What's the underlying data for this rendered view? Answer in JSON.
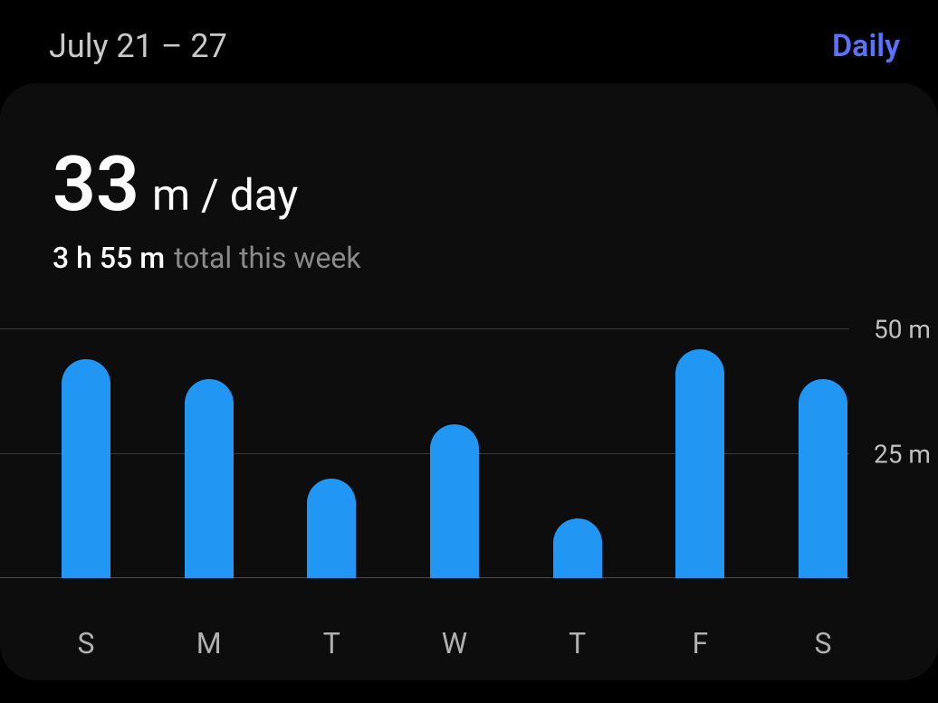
{
  "header": {
    "date_range": "July 21 – 27",
    "view_mode": "Daily"
  },
  "stats": {
    "avg_value": "33",
    "avg_unit": "m / day",
    "total_value": "3 h 55 m",
    "total_label": "total this week"
  },
  "chart_data": {
    "type": "bar",
    "categories": [
      "S",
      "M",
      "T",
      "W",
      "T",
      "F",
      "S"
    ],
    "values": [
      44,
      40,
      20,
      31,
      12,
      46,
      40
    ],
    "title": "",
    "xlabel": "",
    "ylabel": "",
    "ylim": [
      0,
      50
    ],
    "y_ticks": [
      {
        "value": 25,
        "label": "25 m"
      },
      {
        "value": 50,
        "label": "50 m"
      }
    ]
  }
}
